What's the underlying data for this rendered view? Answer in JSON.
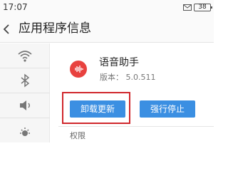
{
  "status_bar": {
    "time": "17:07",
    "battery": "38"
  },
  "header": {
    "title": "应用程序信息"
  },
  "sidebar": {
    "items": [
      {
        "icon": "wifi-icon"
      },
      {
        "icon": "bluetooth-icon"
      },
      {
        "icon": "volume-icon"
      },
      {
        "icon": "brightness-icon"
      }
    ]
  },
  "app": {
    "name": "语音助手",
    "version": "版本： 5.0.511",
    "icon": "voice-assistant-app-icon",
    "icon_color": "#e8423f"
  },
  "buttons": {
    "uninstall_updates": "卸载更新",
    "force_stop": "强行停止"
  },
  "section": {
    "permissions": "权限"
  },
  "colors": {
    "accent": "#3b8fe2",
    "highlight": "#d0272c"
  }
}
